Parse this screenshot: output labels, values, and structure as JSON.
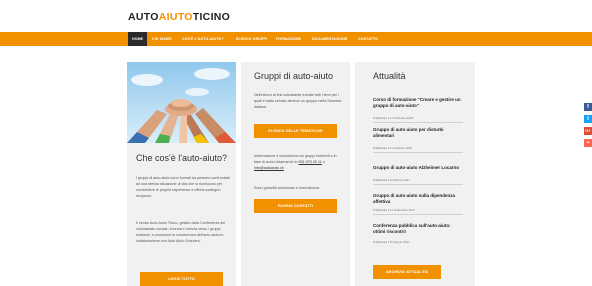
{
  "logo": {
    "part1": "AUTO",
    "part2": "AIUTO",
    "part3": "TICINO"
  },
  "nav": [
    "HOME",
    "CHI SIAMO",
    "COS'È L'AUTO-AIUTO?",
    "ELENCO GRUPPI",
    "FORMAZIONE",
    "DOCUMENTAZIONE",
    "CONTATTO"
  ],
  "card1": {
    "title": "Che cos'è l'auto-aiuto?",
    "p1": "I gruppi di auto-aiuto sono formati da persone confrontate ad una stessa situazione di vita che si riuniscono per condividere le proprie esperienze e offrirsi sostegno reciproco.",
    "p2": "Il centro Auto Aiuto Ticino, gestito dalla Conferenza del volontariato sociale, informa e orienta verso i gruppi esistenti, e promuove la conoscenza dell'auto-aiuto in collaborazione con Auto Aiuto Svizzera.",
    "button": "LEGGI TUTTO"
  },
  "card2": {
    "title": "Gruppi di auto-aiuto",
    "p1": "Nell'elenco al link sottostante trovate tutti i temi per i quali è stato censito almeno un gruppo nella Svizzera italiana.",
    "button1": "ELENCO DELLE TEMATICHE",
    "p2a": "Informazione e consulenza sui gruppi esistenti o in fase di avvio chiamando lo",
    "phone": "091 970 20 11",
    "p2b": "o",
    "email": "info@autoaiuto.ch",
    "p3": "Sono garantiti anonimato e riservatezza.",
    "button2": "PAGINA CONTATTI"
  },
  "card3": {
    "title": "Attualità",
    "news": [
      {
        "title": "Corso di formazione \"Creare e gestire un gruppo di auto-aiuto\"",
        "date": "Pubblicato il 11 Febbraio 2018"
      },
      {
        "title": "Gruppo di auto-aiuto per disturbi alimentari",
        "date": "Pubblicato il 6 Febbraio 2018"
      },
      {
        "title": "Gruppo di auto-aiuto Alzheimer Locarno",
        "date": "Pubblicato il 9 Ottobre 2017"
      },
      {
        "title": "Gruppo di auto-aiuto sulla dipendenza affettiva",
        "date": "Pubblicato il 11 Settembre 2017"
      },
      {
        "title": "Conferenza pubblica sull'auto-aiuto: ottimi riscontri!",
        "date": "Pubblicato il 8 Giugno 2017"
      }
    ],
    "button": "ARCHIVIO ATTUALITÀ"
  },
  "social": {
    "fb": "f",
    "tw": "t",
    "gp": "G+",
    "plus": "+"
  },
  "colors": {
    "accent": "#f29100",
    "nav_active": "#2b2b2b",
    "card_bg": "#f1f1f1"
  }
}
